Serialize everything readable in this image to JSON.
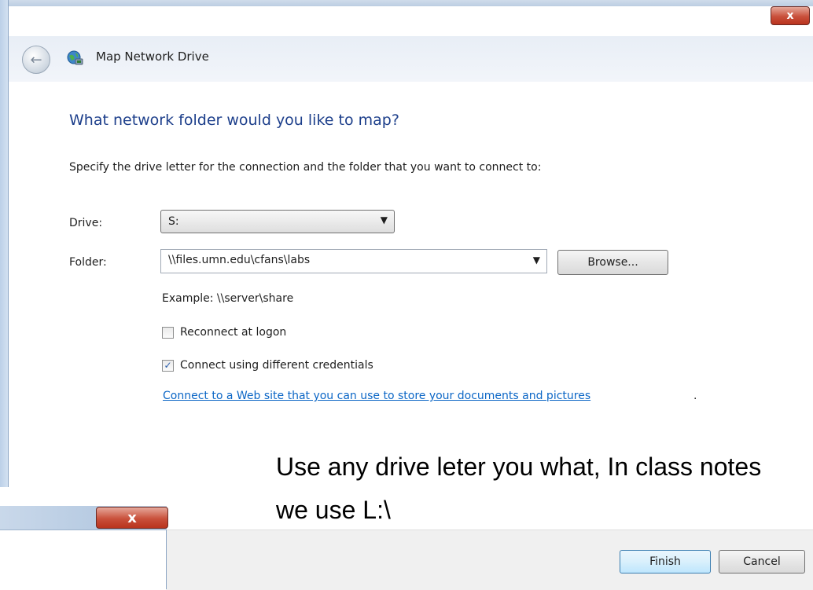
{
  "window": {
    "title": "Map Network Drive",
    "close_glyph": "x"
  },
  "header": {
    "back_icon": "back-arrow-icon",
    "app_icon": "network-globe-icon"
  },
  "main": {
    "heading": "What network folder would you like to map?",
    "instruction": "Specify the drive letter for the connection and the folder that you want to connect to:",
    "drive": {
      "label": "Drive:",
      "value": "S:"
    },
    "folder": {
      "label": "Folder:",
      "value": "\\\\files.umn.edu\\cfans\\labs"
    },
    "browse_label": "Browse...",
    "example": "Example: \\\\server\\share",
    "reconnect": {
      "label": "Reconnect at logon",
      "checked": false
    },
    "credentials": {
      "label": "Connect using different credentials",
      "checked": true
    },
    "web_link": "Connect to a Web site that you can use to store your documents and pictures",
    "web_link_suffix": "."
  },
  "annotation": {
    "text": "Use any drive leter you what,  In class notes we use L:\\"
  },
  "footer": {
    "finish_label": "Finish",
    "cancel_label": "Cancel"
  },
  "colors": {
    "heading": "#1d3f8b",
    "link": "#0b66c6",
    "close_red": "#c9503b"
  }
}
